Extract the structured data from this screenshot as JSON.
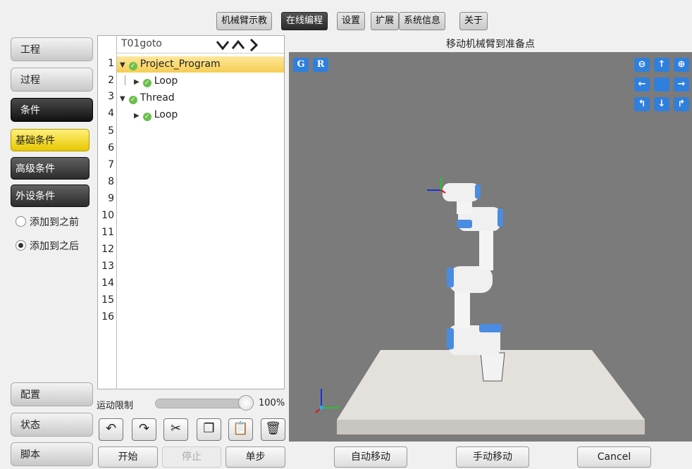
{
  "top_tabs": [
    "机械臂示教",
    "在线编程",
    "设置",
    "扩展",
    "系统信息",
    "关于"
  ],
  "active_tab": "在线编程",
  "sidebar": {
    "items": [
      "工程",
      "过程",
      "条件"
    ],
    "sub_items": [
      "基础条件",
      "高级条件",
      "外设条件"
    ],
    "radio_options": [
      "添加到之前",
      "添加到之后"
    ],
    "radio_selected": "添加到之后",
    "bottom_items": [
      "配置",
      "状态",
      "脚本"
    ]
  },
  "program": {
    "name": "T01goto",
    "line_numbers": [
      "1",
      "2",
      "3",
      "4",
      "5",
      "6",
      "7",
      "8",
      "9",
      "10",
      "11",
      "12",
      "13",
      "14",
      "15",
      "16"
    ],
    "tree": [
      {
        "label": "Project_Program"
      },
      {
        "label": "Loop"
      },
      {
        "label": "Thread"
      },
      {
        "label": "Loop"
      }
    ]
  },
  "motion_limit": {
    "label": "运动限制",
    "value_text": "100%",
    "fraction": 1.0
  },
  "run_controls": {
    "start": "开始",
    "stop": "停止",
    "step": "单步"
  },
  "viewport": {
    "title": "移动机械臂到准备点",
    "g_label": "G",
    "r_label": "R",
    "nav_icons": [
      "zoom-out-icon",
      "arrow-up-icon",
      "zoom-in-icon",
      "arrow-left-icon",
      "center-icon",
      "arrow-right-icon",
      "rotate-left-icon",
      "arrow-down-icon",
      "rotate-right-icon"
    ]
  },
  "footer": {
    "auto_move": "自动移动",
    "manual_move": "手动移动",
    "cancel": "Cancel"
  },
  "colors": {
    "accent_blue": "#2f7fdc",
    "tab_active": "#2a2a2a",
    "highlight_yellow": "#f5e060",
    "viewport_bg": "#7b7b7b"
  }
}
